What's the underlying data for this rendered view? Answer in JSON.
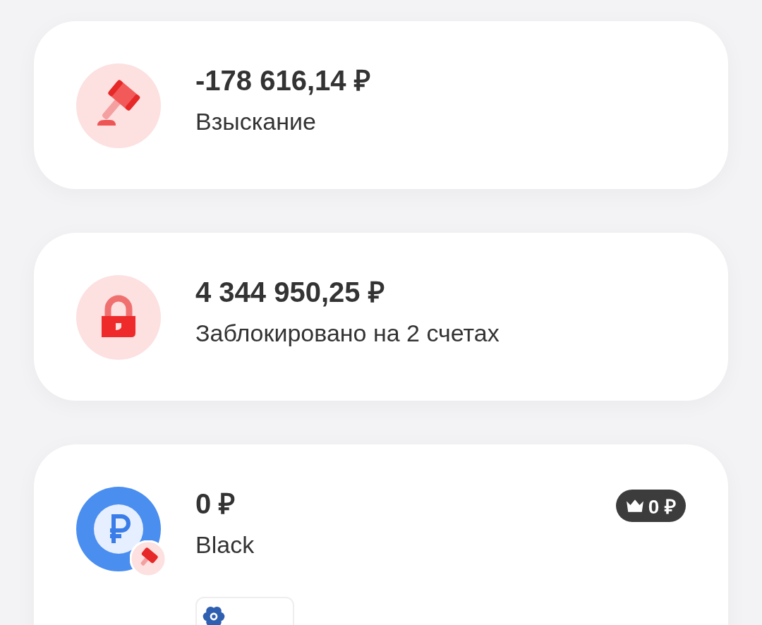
{
  "cards": [
    {
      "kind": "penalty",
      "amount": "-178 616,14 ₽",
      "label": "Взыскание"
    },
    {
      "kind": "blocked",
      "amount": "4 344 950,25 ₽",
      "label": "Заблокировано на 2 счетах"
    },
    {
      "kind": "account",
      "amount": "0 ₽",
      "label": "Black",
      "badge": "0 ₽",
      "penalty_mark": true,
      "has_card_tile": true
    }
  ]
}
